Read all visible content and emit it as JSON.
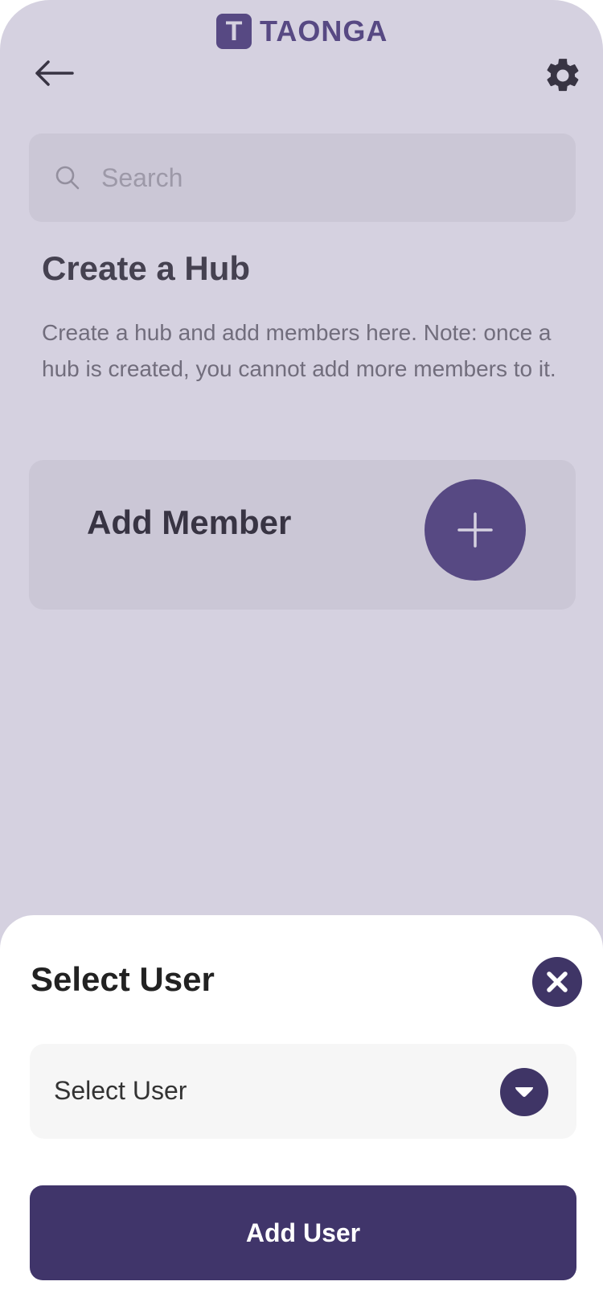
{
  "header": {
    "logo_letter": "T",
    "logo_text": "TAONGA",
    "back_icon": "arrow-left-icon",
    "settings_icon": "gear-icon"
  },
  "search": {
    "placeholder": "Search",
    "value": ""
  },
  "hub": {
    "title": "Create a Hub",
    "description": "Create a hub and add members here. Note: once a hub is created, you cannot add more members to it."
  },
  "member_card": {
    "label": "Add Member",
    "add_icon": "plus-icon"
  },
  "sheet": {
    "title": "Select User",
    "close_icon": "close-icon",
    "select_value": "Select User",
    "dropdown_icon": "chevron-down-icon",
    "submit_label": "Add User"
  },
  "colors": {
    "brand": "#5b4f86",
    "brand_dark": "#40356a",
    "overlay": "#483a78"
  }
}
